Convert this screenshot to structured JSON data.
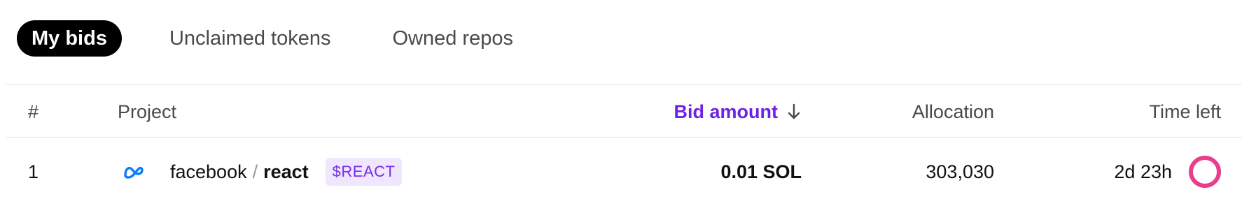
{
  "tabs": [
    {
      "label": "My bids",
      "active": true
    },
    {
      "label": "Unclaimed tokens",
      "active": false
    },
    {
      "label": "Owned repos",
      "active": false
    }
  ],
  "table": {
    "headers": {
      "num": "#",
      "project": "Project",
      "bid_amount": "Bid amount",
      "allocation": "Allocation",
      "time_left": "Time left"
    },
    "sort": {
      "column": "bid_amount",
      "direction": "descending",
      "icon": "arrow-down-icon"
    },
    "rows": [
      {
        "num": "1",
        "logo": "meta-logo-icon",
        "owner": "facebook",
        "separator": "/",
        "repo": "react",
        "token": "$REACT",
        "bid_amount": "0.01 SOL",
        "allocation": "303,030",
        "time_left": "2d 23h",
        "timer_icon": "timer-ring-icon"
      }
    ]
  },
  "colors": {
    "accent": "#6d22e6",
    "token_bg": "#efe6ff",
    "token_text": "#7a2ee6",
    "timer": "#ea3d8c",
    "meta_blue": "#0a7cff"
  }
}
